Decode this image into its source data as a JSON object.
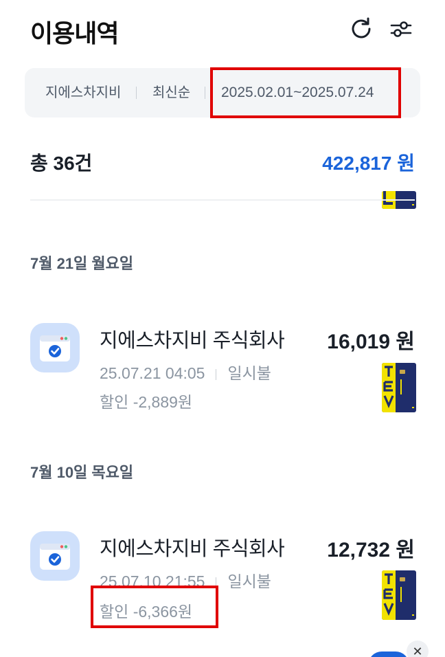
{
  "header": {
    "title": "이용내역",
    "refresh_icon": "refresh-icon",
    "filter_icon": "sliders-icon"
  },
  "filters": {
    "merchant": "지에스차지비",
    "sort": "최신순",
    "date_range": "2025.02.01~2025.07.24"
  },
  "summary": {
    "count": "총 36건",
    "total": "422,817 원"
  },
  "groups": [
    {
      "date": "7월 21일 월요일",
      "transaction": {
        "merchant": "지에스차지비 주식회사",
        "amount": "16,019 원",
        "datetime": "25.07.21 04:05",
        "installment": "일시불",
        "discount": "할인 -2,889원"
      }
    },
    {
      "date": "7월 10일 목요일",
      "transaction": {
        "merchant": "지에스차지비 주식회사",
        "amount": "12,732 원",
        "datetime": "25.07.10 21:55",
        "installment": "일시불",
        "discount": "할인 -6,366원"
      }
    }
  ],
  "colors": {
    "accent": "#1b64da",
    "highlight": "#e00000",
    "card_navy": "#1f2d6b",
    "card_yellow": "#f2e200"
  }
}
